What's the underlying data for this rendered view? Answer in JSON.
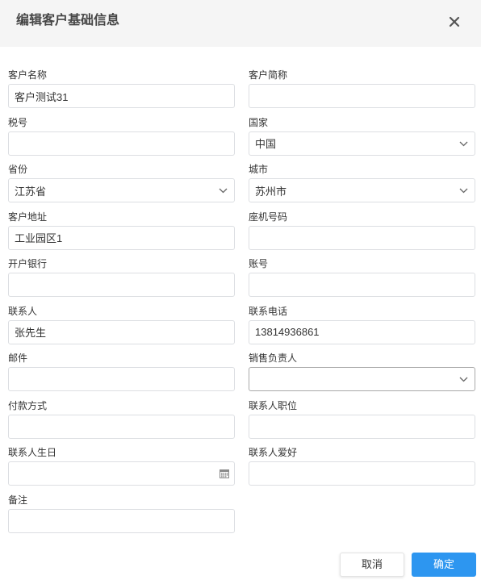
{
  "dialog": {
    "title": "编辑客户基础信息"
  },
  "form": {
    "customer_name": {
      "label": "客户名称",
      "value": "客户测试31"
    },
    "customer_short_name": {
      "label": "客户简称",
      "value": ""
    },
    "tax_number": {
      "label": "税号",
      "value": ""
    },
    "country": {
      "label": "国家",
      "value": "中国"
    },
    "province": {
      "label": "省份",
      "value": "江苏省"
    },
    "city": {
      "label": "城市",
      "value": "苏州市"
    },
    "address": {
      "label": "客户地址",
      "value": "工业园区1"
    },
    "landline": {
      "label": "座机号码",
      "value": ""
    },
    "bank": {
      "label": "开户银行",
      "value": ""
    },
    "account": {
      "label": "账号",
      "value": ""
    },
    "contact": {
      "label": "联系人",
      "value": "张先生"
    },
    "contact_phone": {
      "label": "联系电话",
      "value": "13814936861"
    },
    "email": {
      "label": "邮件",
      "value": ""
    },
    "sales_owner": {
      "label": "销售负责人",
      "value": ""
    },
    "payment_method": {
      "label": "付款方式",
      "value": ""
    },
    "contact_position": {
      "label": "联系人职位",
      "value": ""
    },
    "contact_birthday": {
      "label": "联系人生日",
      "value": ""
    },
    "contact_hobby": {
      "label": "联系人爱好",
      "value": ""
    },
    "remark": {
      "label": "备注",
      "value": ""
    }
  },
  "footer": {
    "cancel_label": "取消",
    "confirm_label": "确定"
  },
  "icons": {
    "close": "close-icon",
    "dropdown": "chevron-down-icon",
    "date": "calendar-icon"
  },
  "colors": {
    "header_bg": "#f5f5f5",
    "border": "#dcdee2",
    "focus_border": "#a9a9a9",
    "primary": "#2d96f0",
    "text": "#333333",
    "title": "#464646"
  }
}
